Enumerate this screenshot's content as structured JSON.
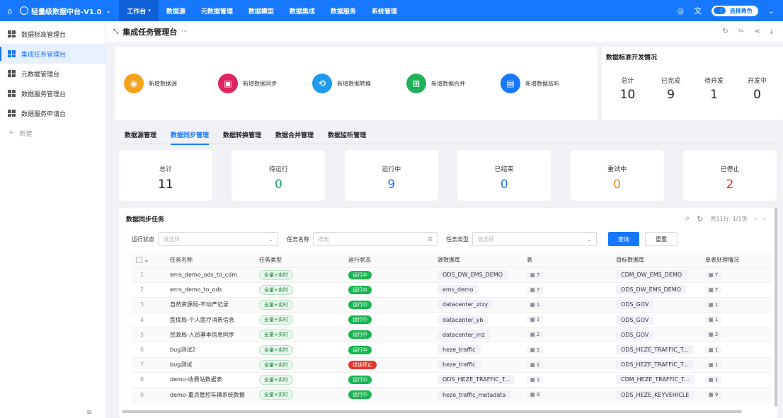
{
  "brand": {
    "title": "轻量级数据中台-V1.0"
  },
  "nav": {
    "items": [
      "工作台",
      "数据源",
      "元数据管理",
      "数据模型",
      "数据集成",
      "数据服务",
      "系统管理"
    ]
  },
  "topbar": {
    "role_label": "选择角色"
  },
  "sidebar": {
    "items": [
      "数据标准管理台",
      "集成任务管理台",
      "元数据管理台",
      "数据服务管理台",
      "数据服务申请台"
    ],
    "add_label": "新建"
  },
  "page": {
    "title": "集成任务管理台"
  },
  "quick": [
    {
      "label": "新增数据源",
      "color": "#f7a21b"
    },
    {
      "label": "新增数据同步",
      "color": "#e0245e"
    },
    {
      "label": "新增数据转换",
      "color": "#1e9bf0"
    },
    {
      "label": "新增数据合并",
      "color": "#22b15b"
    },
    {
      "label": "新增数据监听",
      "color": "#1677ff"
    }
  ],
  "standard": {
    "title": "数据标准开发情况",
    "stats": [
      {
        "label": "总计",
        "value": "10"
      },
      {
        "label": "已完成",
        "value": "9"
      },
      {
        "label": "待开发",
        "value": "1"
      },
      {
        "label": "开发中",
        "value": "0"
      }
    ]
  },
  "tabs": [
    "数据源管理",
    "数据同步管理",
    "数据转换管理",
    "数据合并管理",
    "数据监听管理"
  ],
  "stats": [
    {
      "label": "总计",
      "value": "11",
      "color": "#222222"
    },
    {
      "label": "待运行",
      "value": "0",
      "color": "#22a05a"
    },
    {
      "label": "运行中",
      "value": "9",
      "color": "#1677ff"
    },
    {
      "label": "已结束",
      "value": "0",
      "color": "#1677ff"
    },
    {
      "label": "重试中",
      "value": "0",
      "color": "#f08c1b"
    },
    {
      "label": "已停止",
      "value": "2",
      "color": "#e5352b"
    }
  ],
  "table": {
    "title": "数据同步任务",
    "pagination": "共11行, 1/1页",
    "filters": {
      "status_label": "运行状态",
      "status_placeholder": "请选择",
      "name_label": "任务名称",
      "name_placeholder": "搜索",
      "type_label": "任务类型",
      "type_placeholder": "请选择",
      "query": "查询",
      "reset": "重置"
    },
    "columns": [
      "任务名称",
      "任务类型",
      "运行状态",
      "源数据库",
      "表",
      "目标数据库",
      "单表处理情况"
    ],
    "rows": [
      {
        "idx": "1",
        "name": "ems_demo_ods_to_cdm",
        "type": "全量+实时",
        "status": "运行中",
        "src": "ODS_DW_EMS_DEMO",
        "tables": "7",
        "dst": "CDM_DW_EMS_DEMO",
        "single": "7"
      },
      {
        "idx": "2",
        "name": "ems_demo_to_ods",
        "type": "全量+实时",
        "status": "运行中",
        "src": "ems_demo",
        "tables": "7",
        "dst": "ODS_DW_EMS_DEMO",
        "single": "7"
      },
      {
        "idx": "3",
        "name": "自然资源局-不动产记录",
        "type": "全量+实时",
        "status": "运行中",
        "src": "datacenter_zrzy",
        "tables": "1",
        "dst": "ODS_GOV",
        "single": "1"
      },
      {
        "idx": "4",
        "name": "医保局-个人医疗消费信息",
        "type": "全量+实时",
        "status": "运行中",
        "src": "datacenter_yb",
        "tables": "1",
        "dst": "ODS_GOV",
        "single": "1"
      },
      {
        "idx": "5",
        "name": "民政局-人员基本信息同步",
        "type": "全量+实时",
        "status": "运行中",
        "src": "datacenter_mz",
        "tables": "2",
        "dst": "ODS_GOV",
        "single": "2"
      },
      {
        "idx": "6",
        "name": "bug测试2",
        "type": "全量+实时",
        "status": "运行中",
        "src": "heze_traffic",
        "tables": "1",
        "dst": "ODS_HEZE_TRAFFIC_T...",
        "single": "1"
      },
      {
        "idx": "7",
        "name": "bug测试",
        "type": "全量+实时",
        "status": "错误停止",
        "src": "heze_traffic",
        "tables": "1",
        "dst": "ODS_HEZE_TRAFFIC_T...",
        "single": "1"
      },
      {
        "idx": "8",
        "name": "demo-收费站数据表",
        "type": "全量+实时",
        "status": "运行中",
        "src": "ODS_HEZE_TRAFFIC_T...",
        "tables": "1",
        "dst": "CDM_HEZE_TRAFFIC_T...",
        "single": "1"
      },
      {
        "idx": "9",
        "name": "demo-重点管控车辆系统数据",
        "type": "全量+实时",
        "status": "运行中",
        "src": "heze_traffic_metadata",
        "tables": "9",
        "dst": "ODS_HEZE_KEYVEHICLE",
        "single": "9"
      }
    ]
  }
}
